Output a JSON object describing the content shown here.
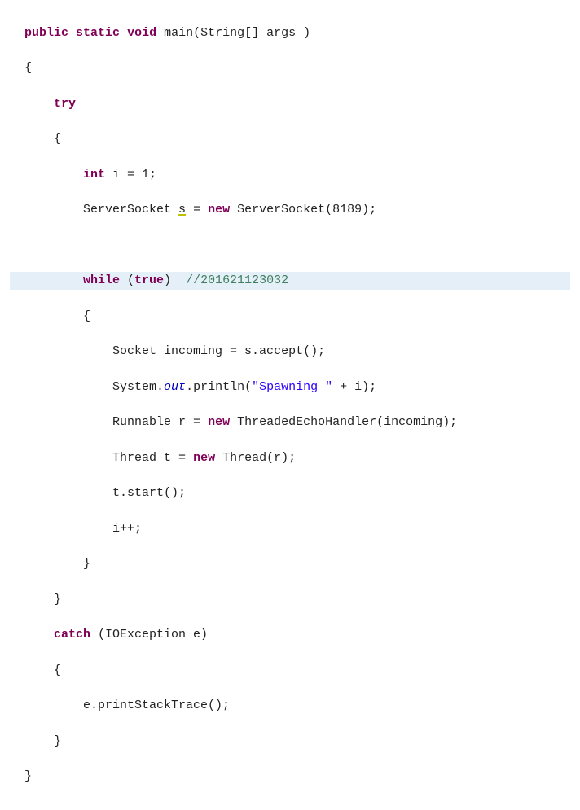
{
  "code": {
    "kw_public": "public",
    "kw_static": "static",
    "kw_void": "void",
    "kw_main": "main",
    "param": "(String[] args )",
    "brace_open": "{",
    "brace_close": "}",
    "kw_try": "try",
    "kw_int": "int",
    "int_decl": " i = 1;",
    "ss_decl_a": "ServerSocket ",
    "ss_var": "s",
    "ss_decl_b": " = ",
    "kw_new": "new",
    "ss_ctor": " ServerSocket(8189);",
    "kw_while": "while",
    "while_cond": " (",
    "kw_true": "true",
    "while_cond_end": ")  ",
    "comment": "//201621123032",
    "sock_decl_a": "Socket incoming = s.accept();",
    "sys": "System.",
    "out": "out",
    "println_a": ".println(",
    "str_spawn": "\"Spawning \"",
    "println_b": " + i);",
    "runnable_a": "Runnable r = ",
    "runnable_b": " ThreadedEchoHandler(incoming);",
    "thread_a": "Thread t = ",
    "thread_b": " Thread(r);",
    "tstart": "t.start();",
    "ipp": "i++;",
    "kw_catch": "catch",
    "catch_param": " (IOException e)",
    "eprint": "e.printStackTrace();"
  }
}
